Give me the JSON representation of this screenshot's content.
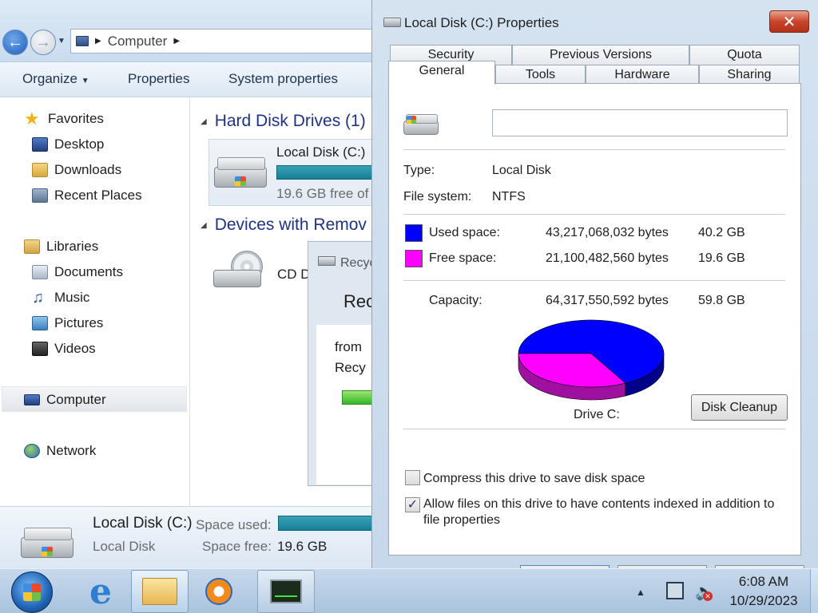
{
  "explorer": {
    "address_root": "Computer",
    "toolbar": {
      "organize": "Organize",
      "properties": "Properties",
      "system_properties": "System properties"
    },
    "nav": {
      "favorites": "Favorites",
      "desktop": "Desktop",
      "downloads": "Downloads",
      "recent_places": "Recent Places",
      "libraries": "Libraries",
      "documents": "Documents",
      "music": "Music",
      "pictures": "Pictures",
      "videos": "Videos",
      "computer": "Computer",
      "network": "Network"
    },
    "content": {
      "group_hdd": "Hard Disk Drives (1)",
      "group_removable": "Devices with Remov",
      "drive_name": "Local Disk (C:)",
      "drive_free": "19.6 GB free of",
      "cd_label": "CD D"
    },
    "details": {
      "name": "Local Disk (C:)",
      "type": "Local Disk",
      "used_label": "Space used:",
      "free_label": "Space free:",
      "free_value": "19.6 GB"
    },
    "recycle": {
      "title": "Recyc",
      "heading": "Rec",
      "line1": "from",
      "line2": "Recy"
    }
  },
  "dialog": {
    "title": "Local Disk (C:) Properties",
    "close_label": "✕",
    "tabs_row1": [
      "Security",
      "Previous Versions",
      "Quota"
    ],
    "tabs_row2": [
      "General",
      "Tools",
      "Hardware",
      "Sharing"
    ],
    "label_value": "",
    "type_label": "Type:",
    "type_value": "Local Disk",
    "fs_label": "File system:",
    "fs_value": "NTFS",
    "used": {
      "label": "Used space:",
      "bytes": "43,217,068,032 bytes",
      "size": "40.2 GB",
      "color": "#0000ff"
    },
    "free": {
      "label": "Free space:",
      "bytes": "21,100,482,560 bytes",
      "size": "19.6 GB",
      "color": "#ff00ff"
    },
    "capacity": {
      "label": "Capacity:",
      "bytes": "64,317,550,592 bytes",
      "size": "59.8 GB"
    },
    "drive_caption": "Drive C:",
    "disk_cleanup": "Disk Cleanup",
    "compress": {
      "label": "Compress this drive to save disk space",
      "checked": false
    },
    "index": {
      "line1": "Allow files on this drive to have contents indexed in addition to",
      "line2": "file properties",
      "checked": true
    }
  },
  "taskbar": {
    "time": "6:08 AM",
    "date": "10/29/2023"
  }
}
